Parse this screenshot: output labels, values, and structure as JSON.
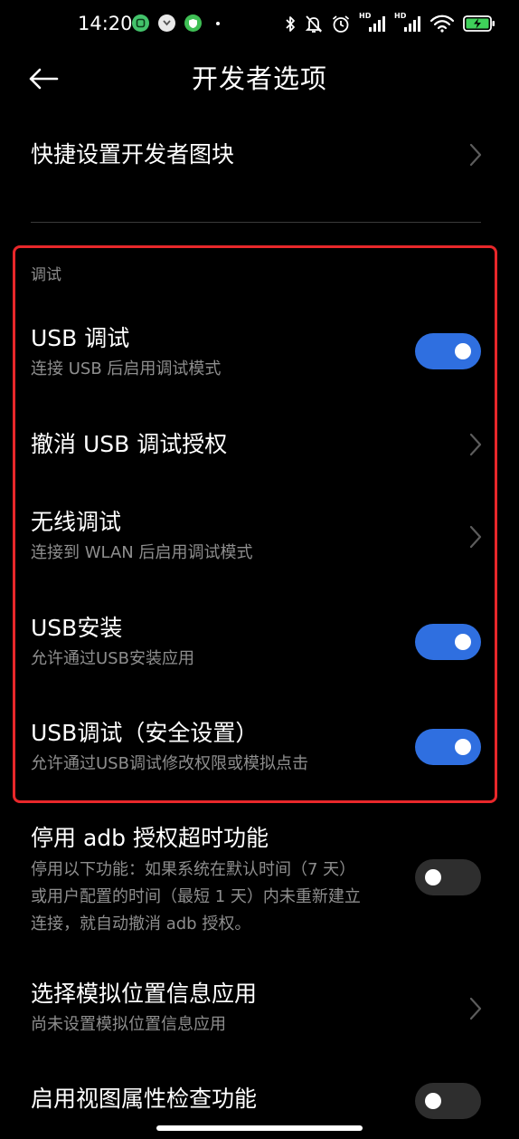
{
  "status_bar": {
    "time": "14:20",
    "notification_icons": [
      "app-icon-green",
      "app-icon-white",
      "app-icon-shield"
    ],
    "hd_label": "HD",
    "battery_color": "#3fd15a"
  },
  "header": {
    "title": "开发者选项"
  },
  "items": {
    "quick_tiles": {
      "title": "快捷设置开发者图块"
    },
    "section_debug": {
      "label": "调试"
    },
    "usb_debug": {
      "title": "USB 调试",
      "subtitle": "连接 USB 后启用调试模式",
      "enabled": true
    },
    "revoke_usb_auth": {
      "title": "撤消 USB 调试授权"
    },
    "wireless_debug": {
      "title": "无线调试",
      "subtitle": "连接到 WLAN 后启用调试模式"
    },
    "usb_install": {
      "title": "USB安装",
      "subtitle": "允许通过USB安装应用",
      "enabled": true
    },
    "usb_debug_secure": {
      "title": "USB调试（安全设置）",
      "subtitle": "允许通过USB调试修改权限或模拟点击",
      "enabled": true
    },
    "disable_adb_timeout": {
      "title": "停用 adb 授权超时功能",
      "subtitle_line1": "停用以下功能：如果系统在默认时间（7 天）",
      "subtitle_line2": "或用户配置的时间（最短 1 天）内未重新建立",
      "subtitle_line3": "连接，就自动撤消 adb 授权。",
      "enabled": false
    },
    "mock_location": {
      "title": "选择模拟位置信息应用",
      "subtitle": "尚未设置模拟位置信息应用"
    },
    "view_attr_inspect": {
      "title": "启用视图属性检查功能",
      "enabled": false
    }
  },
  "colors": {
    "toggle_on": "#2f6fe0",
    "toggle_off": "#2e2e2e",
    "highlight": "#e8272a"
  }
}
